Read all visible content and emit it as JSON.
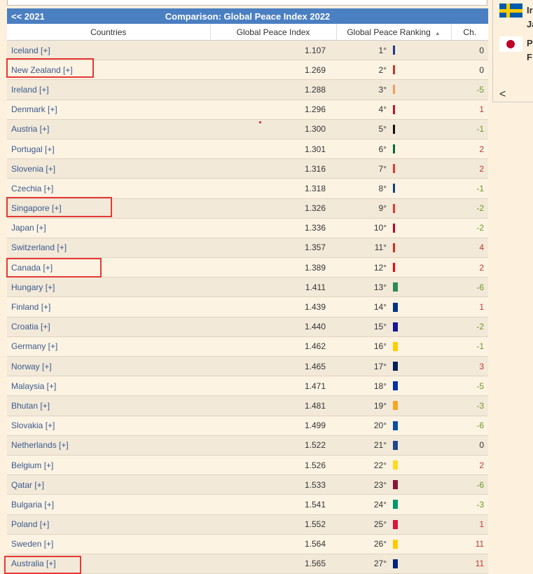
{
  "header": {
    "prev_label": "<<  2021",
    "title": "Comparison: Global Peace Index 2022"
  },
  "columns": {
    "countries": "Countries",
    "gpi": "Global Peace Index",
    "ranking": "Global Peace Ranking",
    "change": "Ch."
  },
  "rows": [
    {
      "country": "Iceland [+]",
      "gpi": "1.107",
      "rank": "1°",
      "color": "#1f3c88",
      "change": "0",
      "dir": "zero",
      "wide": false
    },
    {
      "country": "New Zealand [+]",
      "gpi": "1.269",
      "rank": "2°",
      "color": "#c0392b",
      "change": "0",
      "dir": "zero",
      "wide": false
    },
    {
      "country": "Ireland [+]",
      "gpi": "1.288",
      "rank": "3°",
      "color": "#f39c5a",
      "change": "-5",
      "dir": "neg",
      "wide": false
    },
    {
      "country": "Denmark [+]",
      "gpi": "1.296",
      "rank": "4°",
      "color": "#c8102e",
      "change": "1",
      "dir": "pos",
      "wide": false
    },
    {
      "country": "Austria [+]",
      "gpi": "1.300",
      "rank": "5°",
      "color": "#111111",
      "change": "-1",
      "dir": "neg",
      "wide": false
    },
    {
      "country": "Portugal [+]",
      "gpi": "1.301",
      "rank": "6°",
      "color": "#046a38",
      "change": "2",
      "dir": "pos",
      "wide": false
    },
    {
      "country": "Slovenia [+]",
      "gpi": "1.316",
      "rank": "7°",
      "color": "#e53935",
      "change": "2",
      "dir": "pos",
      "wide": false
    },
    {
      "country": "Czechia [+]",
      "gpi": "1.318",
      "rank": "8°",
      "color": "#11457e",
      "change": "-1",
      "dir": "neg",
      "wide": false
    },
    {
      "country": "Singapore [+]",
      "gpi": "1.326",
      "rank": "9°",
      "color": "#e53935",
      "change": "-2",
      "dir": "neg",
      "wide": false
    },
    {
      "country": "Japan [+]",
      "gpi": "1.336",
      "rank": "10°",
      "color": "#bc002d",
      "change": "-2",
      "dir": "neg",
      "wide": false
    },
    {
      "country": "Switzerland [+]",
      "gpi": "1.357",
      "rank": "11°",
      "color": "#d52b1e",
      "change": "4",
      "dir": "pos",
      "wide": false
    },
    {
      "country": "Canada [+]",
      "gpi": "1.389",
      "rank": "12°",
      "color": "#ff0000",
      "change": "2",
      "dir": "pos",
      "wide": false
    },
    {
      "country": "Hungary [+]",
      "gpi": "1.411",
      "rank": "13°",
      "color": "#2e8b57",
      "change": "-6",
      "dir": "neg",
      "wide": true
    },
    {
      "country": "Finland [+]",
      "gpi": "1.439",
      "rank": "14°",
      "color": "#003580",
      "change": "1",
      "dir": "pos",
      "wide": true
    },
    {
      "country": "Croatia [+]",
      "gpi": "1.440",
      "rank": "15°",
      "color": "#171796",
      "change": "-2",
      "dir": "neg",
      "wide": true
    },
    {
      "country": "Germany [+]",
      "gpi": "1.462",
      "rank": "16°",
      "color": "#ffce00",
      "change": "-1",
      "dir": "neg",
      "wide": true
    },
    {
      "country": "Norway [+]",
      "gpi": "1.465",
      "rank": "17°",
      "color": "#00205b",
      "change": "3",
      "dir": "pos",
      "wide": true
    },
    {
      "country": "Malaysia [+]",
      "gpi": "1.471",
      "rank": "18°",
      "color": "#0032a0",
      "change": "-5",
      "dir": "neg",
      "wide": true
    },
    {
      "country": "Bhutan [+]",
      "gpi": "1.481",
      "rank": "19°",
      "color": "#f5a623",
      "change": "-3",
      "dir": "neg",
      "wide": true
    },
    {
      "country": "Slovakia [+]",
      "gpi": "1.499",
      "rank": "20°",
      "color": "#0b4ea2",
      "change": "-6",
      "dir": "neg",
      "wide": true
    },
    {
      "country": "Netherlands [+]",
      "gpi": "1.522",
      "rank": "21°",
      "color": "#21468b",
      "change": "0",
      "dir": "zero",
      "wide": true
    },
    {
      "country": "Belgium [+]",
      "gpi": "1.526",
      "rank": "22°",
      "color": "#fdda24",
      "change": "2",
      "dir": "pos",
      "wide": true
    },
    {
      "country": "Qatar [+]",
      "gpi": "1.533",
      "rank": "23°",
      "color": "#8a1538",
      "change": "-6",
      "dir": "neg",
      "wide": true
    },
    {
      "country": "Bulgaria [+]",
      "gpi": "1.541",
      "rank": "24°",
      "color": "#00966e",
      "change": "-3",
      "dir": "neg",
      "wide": true
    },
    {
      "country": "Poland [+]",
      "gpi": "1.552",
      "rank": "25°",
      "color": "#dc143c",
      "change": "1",
      "dir": "pos",
      "wide": true
    },
    {
      "country": "Sweden [+]",
      "gpi": "1.564",
      "rank": "26°",
      "color": "#fecc00",
      "change": "11",
      "dir": "pos",
      "wide": true
    },
    {
      "country": "Australia [+]",
      "gpi": "1.565",
      "rank": "27°",
      "color": "#00247d",
      "change": "11",
      "dir": "pos",
      "wide": true
    }
  ],
  "side": {
    "item1_text": "Ir\nJa",
    "item1_line1": "Ir",
    "item1_line2": "Ja",
    "item2_line1": "P",
    "item2_line2": "F",
    "arrow": "<"
  }
}
